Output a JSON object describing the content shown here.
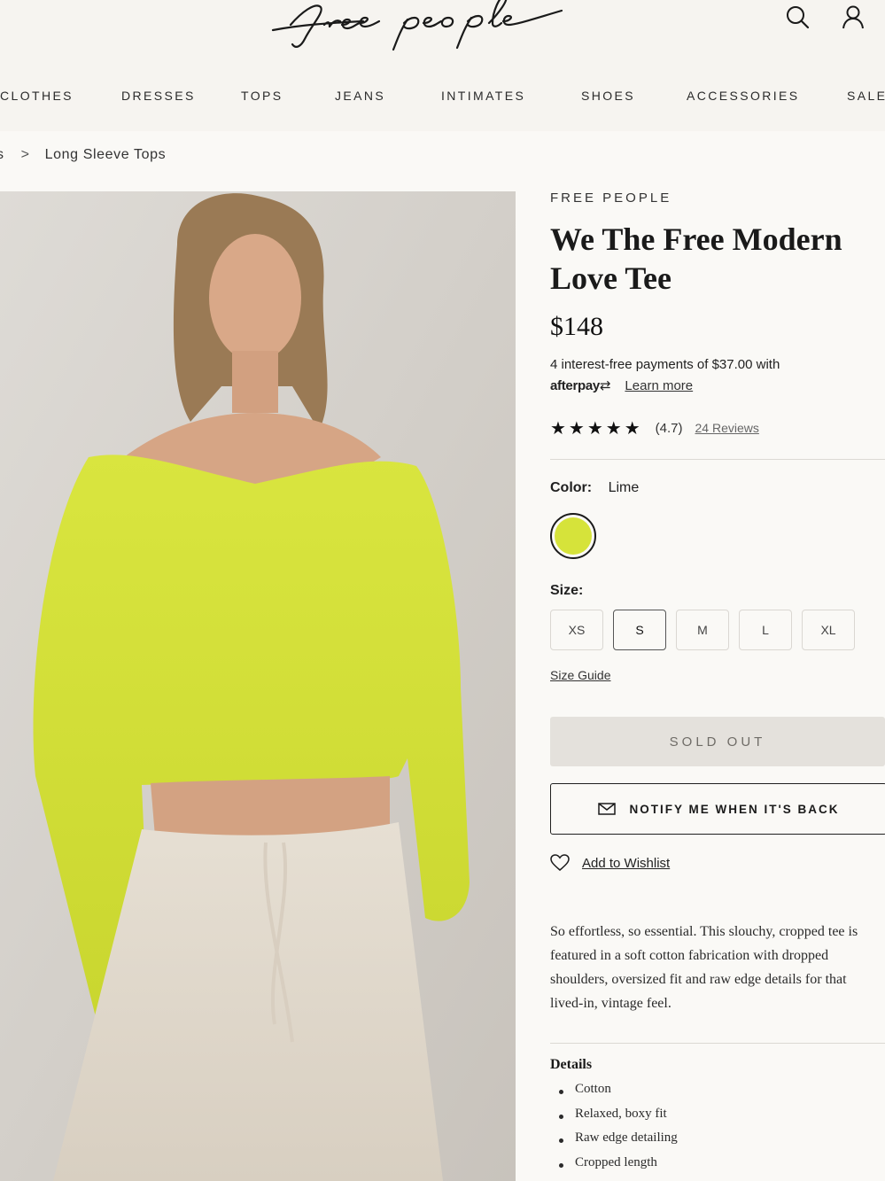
{
  "header": {
    "logo_text": "free people",
    "icons": [
      "search-icon",
      "account-icon"
    ]
  },
  "nav": {
    "items": [
      "CLOTHES",
      "DRESSES",
      "TOPS",
      "JEANS",
      "INTIMATES",
      "SHOES",
      "ACCESSORIES",
      "SALE"
    ]
  },
  "breadcrumb": {
    "current": "Long Sleeve Tops"
  },
  "product": {
    "brand": "FREE PEOPLE",
    "title": "We The Free Modern Love Tee",
    "price": "$148",
    "afterpay_text": "4 interest-free payments of $37.00 with",
    "afterpay_logo": "afterpay",
    "learn_more": "Learn more",
    "rating_value": "(4.7)",
    "rating_stars": 4.7,
    "reviews_link": "24 Reviews",
    "color_label": "Color:",
    "color_value": "Lime",
    "color_hex": "#d6e33a",
    "size_label": "Size:",
    "sizes": [
      "XS",
      "S",
      "M",
      "L",
      "XL"
    ],
    "selected_size": "S",
    "size_guide": "Size Guide",
    "sold_out": "SOLD OUT",
    "notify": "NOTIFY ME WHEN IT'S BACK",
    "wishlist": "Add to Wishlist",
    "description": "So effortless, so essential. This slouchy, cropped tee is featured in a soft cotton fabrication with dropped shoulders, oversized fit and raw edge details for that lived-in, vintage feel.",
    "details_heading": "Details",
    "details": [
      "Cotton",
      "Relaxed, boxy fit",
      "Raw edge detailing",
      "Cropped length"
    ]
  },
  "colors": {
    "page_bg": "#faf9f6",
    "header_bg": "#f6f4f0",
    "lime": "#d6e33a",
    "sold_out_bg": "#e4e1dc"
  }
}
